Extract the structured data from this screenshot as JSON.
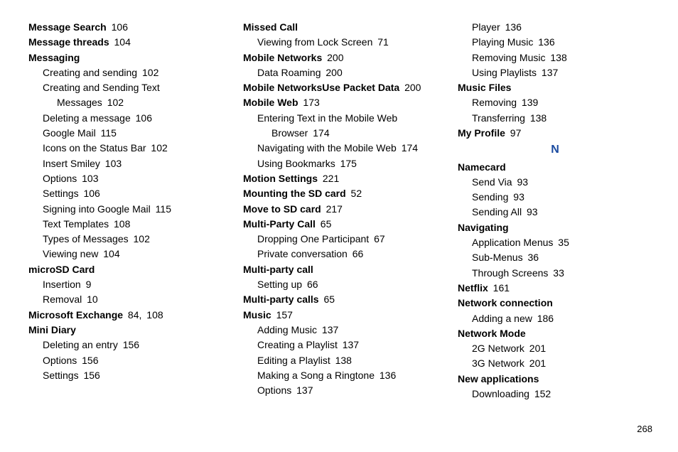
{
  "page_number": "268",
  "section_letter": "N",
  "col1": [
    {
      "type": "head",
      "label": "Message Search",
      "page": "106"
    },
    {
      "type": "head",
      "label": "Message threads",
      "page": "104"
    },
    {
      "type": "head",
      "label": "Messaging"
    },
    {
      "type": "sub",
      "label": "Creating and sending",
      "page": "102"
    },
    {
      "type": "sub",
      "label": "Creating and Sending Text"
    },
    {
      "type": "sub2",
      "label": "Messages",
      "page": "102"
    },
    {
      "type": "sub",
      "label": "Deleting a message",
      "page": "106"
    },
    {
      "type": "sub",
      "label": "Google Mail",
      "page": "115"
    },
    {
      "type": "sub",
      "label": "Icons on the Status Bar",
      "page": "102"
    },
    {
      "type": "sub",
      "label": "Insert Smiley",
      "page": "103"
    },
    {
      "type": "sub",
      "label": "Options",
      "page": "103"
    },
    {
      "type": "sub",
      "label": "Settings",
      "page": "106"
    },
    {
      "type": "sub",
      "label": "Signing into Google Mail",
      "page": "115"
    },
    {
      "type": "sub",
      "label": "Text Templates",
      "page": "108"
    },
    {
      "type": "sub",
      "label": "Types of Messages",
      "page": "102"
    },
    {
      "type": "sub",
      "label": "Viewing new",
      "page": "104"
    },
    {
      "type": "head",
      "label": "microSD Card"
    },
    {
      "type": "sub",
      "label": "Insertion",
      "page": "9"
    },
    {
      "type": "sub",
      "label": "Removal",
      "page": "10"
    },
    {
      "type": "head",
      "label": "Microsoft Exchange",
      "page": "84",
      "page2": "108"
    },
    {
      "type": "head",
      "label": "Mini Diary"
    },
    {
      "type": "sub",
      "label": "Deleting an entry",
      "page": "156"
    },
    {
      "type": "sub",
      "label": "Options",
      "page": "156"
    },
    {
      "type": "sub",
      "label": "Settings",
      "page": "156"
    }
  ],
  "col2": [
    {
      "type": "head",
      "label": "Missed Call"
    },
    {
      "type": "sub",
      "label": "Viewing from Lock Screen",
      "page": "71"
    },
    {
      "type": "head",
      "label": "Mobile Networks",
      "page": "200"
    },
    {
      "type": "sub",
      "label": "Data Roaming",
      "page": "200"
    },
    {
      "type": "head",
      "label": "Mobile NetworksUse Packet Data",
      "page": "200"
    },
    {
      "type": "head",
      "label": "Mobile Web",
      "page": "173"
    },
    {
      "type": "sub",
      "label": "Entering Text in the Mobile Web"
    },
    {
      "type": "sub2",
      "label": "Browser",
      "page": "174"
    },
    {
      "type": "sub",
      "label": "Navigating with the Mobile Web",
      "page": "174"
    },
    {
      "type": "sub",
      "label": "Using Bookmarks",
      "page": "175"
    },
    {
      "type": "head",
      "label": "Motion Settings",
      "page": "221"
    },
    {
      "type": "head",
      "label": "Mounting the SD card",
      "page": "52"
    },
    {
      "type": "head",
      "label": "Move to SD card",
      "page": "217"
    },
    {
      "type": "head",
      "label": "Multi-Party Call",
      "page": "65"
    },
    {
      "type": "sub",
      "label": "Dropping One Participant",
      "page": "67"
    },
    {
      "type": "sub",
      "label": "Private conversation",
      "page": "66"
    },
    {
      "type": "head",
      "label": "Multi-party call"
    },
    {
      "type": "sub",
      "label": "Setting up",
      "page": "66"
    },
    {
      "type": "head",
      "label": "Multi-party calls",
      "page": "65"
    },
    {
      "type": "head",
      "label": "Music",
      "page": "157"
    },
    {
      "type": "sub",
      "label": "Adding Music",
      "page": "137"
    },
    {
      "type": "sub",
      "label": "Creating a Playlist",
      "page": "137"
    },
    {
      "type": "sub",
      "label": "Editing a Playlist",
      "page": "138"
    },
    {
      "type": "sub",
      "label": "Making a Song a Ringtone",
      "page": "136"
    },
    {
      "type": "sub",
      "label": "Options",
      "page": "137"
    }
  ],
  "col3_top": [
    {
      "type": "sub",
      "label": "Player",
      "page": "136"
    },
    {
      "type": "sub",
      "label": "Playing Music",
      "page": "136"
    },
    {
      "type": "sub",
      "label": "Removing Music",
      "page": "138"
    },
    {
      "type": "sub",
      "label": "Using Playlists",
      "page": "137"
    },
    {
      "type": "head",
      "label": "Music Files"
    },
    {
      "type": "sub",
      "label": "Removing",
      "page": "139"
    },
    {
      "type": "sub",
      "label": "Transferring",
      "page": "138"
    },
    {
      "type": "head",
      "label": "My Profile",
      "page": "97"
    }
  ],
  "col3_bottom": [
    {
      "type": "head",
      "label": "Namecard"
    },
    {
      "type": "sub",
      "label": "Send Via",
      "page": "93"
    },
    {
      "type": "sub",
      "label": "Sending",
      "page": "93"
    },
    {
      "type": "sub",
      "label": "Sending All",
      "page": "93"
    },
    {
      "type": "head",
      "label": "Navigating"
    },
    {
      "type": "sub",
      "label": "Application Menus",
      "page": "35"
    },
    {
      "type": "sub",
      "label": "Sub-Menus",
      "page": "36"
    },
    {
      "type": "sub",
      "label": "Through Screens",
      "page": "33"
    },
    {
      "type": "head",
      "label": "Netflix",
      "page": "161"
    },
    {
      "type": "head",
      "label": "Network connection"
    },
    {
      "type": "sub",
      "label": "Adding a new",
      "page": "186"
    },
    {
      "type": "head",
      "label": "Network Mode"
    },
    {
      "type": "sub",
      "label": "2G Network",
      "page": "201"
    },
    {
      "type": "sub",
      "label": "3G Network",
      "page": "201"
    },
    {
      "type": "head",
      "label": "New applications"
    },
    {
      "type": "sub",
      "label": "Downloading",
      "page": "152"
    }
  ]
}
